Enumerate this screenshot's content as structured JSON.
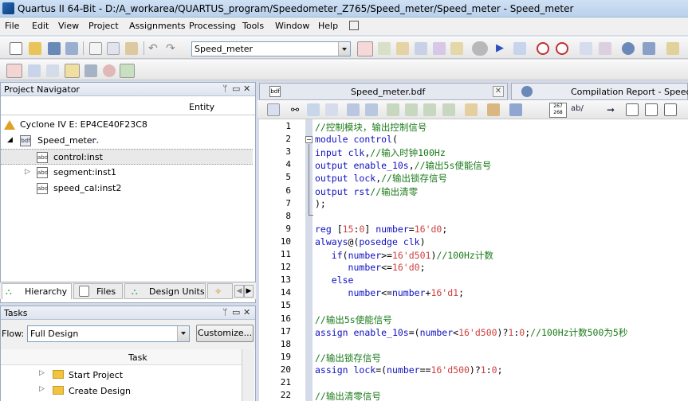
{
  "window": {
    "title": "Quartus II 64-Bit - D:/A_workarea/QUARTUS_program/Speedometer_Z765/Speed_meter/Speed_meter - Speed_meter"
  },
  "menu": [
    "File",
    "Edit",
    "View",
    "Project",
    "Assignments",
    "Processing",
    "Tools",
    "Window",
    "Help"
  ],
  "toolbar": {
    "entity_combo": "Speed_meter"
  },
  "navigator": {
    "title": "Project Navigator",
    "column": "Entity",
    "device": "Cyclone IV E: EP4CE40F23C8",
    "top": "Speed_meter",
    "children": [
      "control:inst",
      "segment:inst1",
      "speed_cal:inst2"
    ]
  },
  "nav_tabs": [
    "Hierarchy",
    "Files",
    "Design Units"
  ],
  "tasks": {
    "title": "Tasks",
    "flow_label": "Flow:",
    "flow_value": "Full Design",
    "customize": "Customize...",
    "column": "Task",
    "items": [
      "Start Project",
      "Create Design"
    ]
  },
  "editor": {
    "tabs": [
      "Speed_meter.bdf",
      "Compilation Report - Speed_m"
    ],
    "lines": [
      {
        "n": "1",
        "t": "//控制模块，输出控制信号"
      },
      {
        "n": "2",
        "t": "module control("
      },
      {
        "n": "3",
        "t": "input clk,//输入时钟100Hz"
      },
      {
        "n": "4",
        "t": "output enable_10s,//输出5s使能信号"
      },
      {
        "n": "5",
        "t": "output lock,//输出锁存信号"
      },
      {
        "n": "6",
        "t": "output rst//输出清零"
      },
      {
        "n": "7",
        "t": ");"
      },
      {
        "n": "8",
        "t": ""
      },
      {
        "n": "9",
        "t": "reg [15:0] number=16'd0;"
      },
      {
        "n": "10",
        "t": "always@(posedge clk)"
      },
      {
        "n": "11",
        "t": "   if(number>=16'd501)//100Hz计数"
      },
      {
        "n": "12",
        "t": "      number<=16'd0;"
      },
      {
        "n": "13",
        "t": "   else"
      },
      {
        "n": "14",
        "t": "      number<=number+16'd1;"
      },
      {
        "n": "15",
        "t": ""
      },
      {
        "n": "16",
        "t": "//输出5s使能信号"
      },
      {
        "n": "17",
        "t": "assign enable_10s=(number<16'd500)?1:0;//100Hz计数500为5秒"
      },
      {
        "n": "18",
        "t": ""
      },
      {
        "n": "19",
        "t": "//输出锁存信号"
      },
      {
        "n": "20",
        "t": "assign lock=(number==16'd500)?1:0;"
      },
      {
        "n": "21",
        "t": ""
      },
      {
        "n": "22",
        "t": "//输出清零信号"
      }
    ],
    "find_badge": "267\n268",
    "ab_label": "ab/"
  }
}
